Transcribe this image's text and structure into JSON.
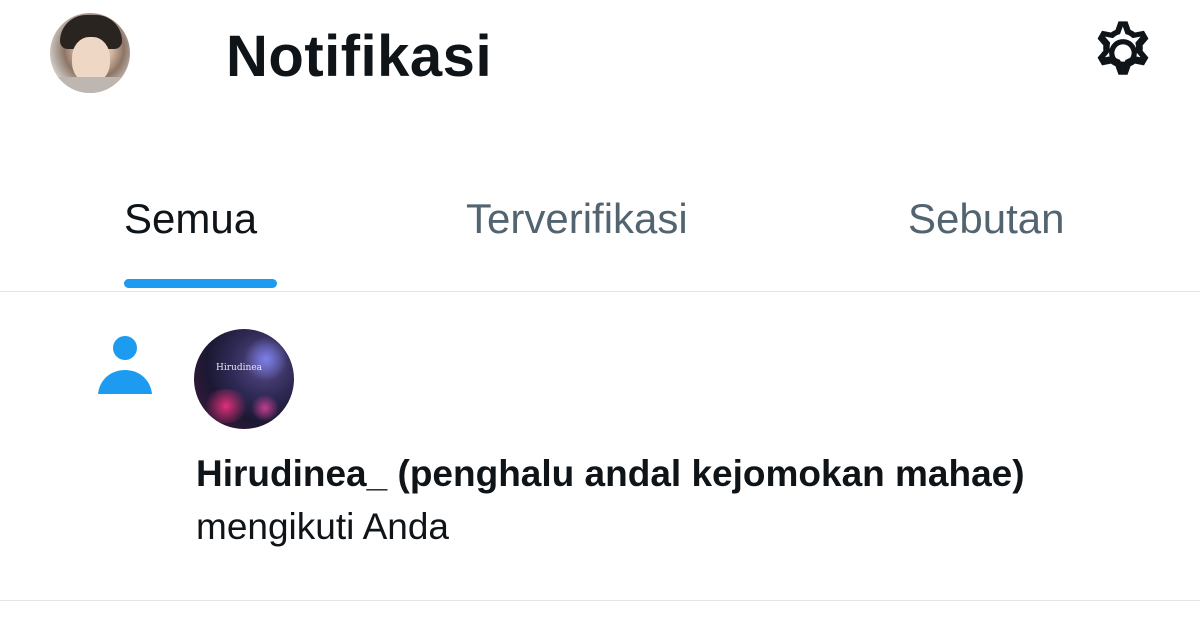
{
  "header": {
    "title": "Notifikasi",
    "avatar_icon": "profile-avatar",
    "settings_icon": "gear-icon"
  },
  "tabs": [
    {
      "label": "Semua",
      "active": true
    },
    {
      "label": "Terverifikasi",
      "active": false
    },
    {
      "label": "Sebutan",
      "active": false
    }
  ],
  "notifications": [
    {
      "type_icon": "person-icon",
      "avatar_stamp": "Hirudinea",
      "user_name": "Hirudinea_ (penghalu andal kejomokan mahae)",
      "action_text": "mengikuti Anda"
    }
  ],
  "colors": {
    "accent": "#1d9bf0",
    "text_primary": "#0f1419",
    "text_secondary": "#536471",
    "divider": "#e1e5e8"
  }
}
